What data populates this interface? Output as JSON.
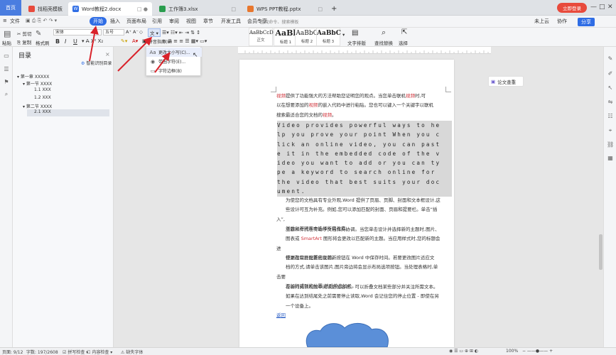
{
  "tabs": {
    "home": "首页",
    "items": [
      {
        "label": "找稻壳模板",
        "color": "#e84a3c"
      },
      {
        "label": "Word教程2.docx",
        "color": "#2f6de5"
      },
      {
        "label": "工作簿3.xlsx",
        "color": "#2a9d4e"
      },
      {
        "label": "WPS PPT教程.pptx",
        "color": "#e8772e"
      }
    ],
    "add": "+",
    "login": "立即登录"
  },
  "menubar": {
    "file": "文件",
    "start": "开始",
    "items": [
      "插入",
      "页面布局",
      "引用",
      "审阅",
      "视图",
      "章节",
      "开发工具",
      "会员专享"
    ],
    "search_placeholder": "查找命令、搜索模板",
    "right": [
      "未上云",
      "协作",
      "分享"
    ]
  },
  "ribbon": {
    "paste": "粘贴",
    "cut": "剪切",
    "copy": "复制",
    "format_painter": "格式刷",
    "font_name": "宋体",
    "font_size": "五号",
    "bold": "B",
    "italic": "I",
    "underline": "U",
    "styles": [
      {
        "sample": "AaBbCcDd",
        "label": "正文"
      },
      {
        "sample": "AaBl",
        "label": "标题 1"
      },
      {
        "sample": "AaBbC",
        "label": "标题 2"
      },
      {
        "sample": "AaBbC",
        "label": "标题 3"
      }
    ],
    "text_layout": "文字排版",
    "find_replace": "查找替换",
    "select": "选择"
  },
  "toc": {
    "title": "目录",
    "smart": "智能识别目录",
    "items": [
      {
        "label": "第一章 XXXXX",
        "level": 1
      },
      {
        "label": "第一节 XXXX",
        "level": 2
      },
      {
        "label": "1.1 XXX",
        "level": 3
      },
      {
        "label": "1.2 XXX",
        "level": 3
      },
      {
        "label": "第二节 XXXX",
        "level": 2
      },
      {
        "label": "2.1 XXX",
        "level": 3,
        "selected": true
      }
    ]
  },
  "dropdown": {
    "items": [
      {
        "icon": "Aa",
        "label": "拼音指南(U)"
      },
      {
        "icon": "Aa",
        "label": "更改大小写(C)..."
      },
      {
        "icon": "◉",
        "label": "带圈字符(E)..."
      },
      {
        "icon": "▭",
        "label": "字符边框(B)"
      }
    ]
  },
  "document": {
    "para1": [
      [
        {
          "t": "视频",
          "k": 1
        },
        {
          "t": "提供了功能强大的方法帮助您证明您的观点。当您单击联机"
        },
        {
          "t": "视频",
          "k": 1
        },
        {
          "t": "时,可"
        }
      ],
      [
        {
          "t": "以在想要添加的"
        },
        {
          "t": "视频",
          "k": 1
        },
        {
          "t": "的嵌入代码中进行粘贴。您也可以键入一个关键字以联机"
        }
      ],
      [
        {
          "t": "搜索最适合您的文档的"
        },
        {
          "t": "视频",
          "k": 1
        },
        {
          "t": "。"
        }
      ]
    ],
    "english_lines": [
      "Video provides powerful ways to he",
      "lp you prove your point When you c",
      "lick an online video, you can past",
      "e it in the embedded code of the v",
      "ideo you want to add or you can ty",
      "pe a keyword to search online for",
      "the video that best suits your doc",
      "ument."
    ],
    "para2": [
      "为使您的文档具有专业外观,Word 提供了页眉、页脚、封面和文本框设计,这",
      "些设计可互为补充。例如,您可以添加匹配的封面、页眉和提要栏。单击“插入”,",
      "然后从不同库中选择所需元素。"
    ],
    "para3": [
      [
        {
          "t": "主题和样式也有助于文档保持协调。当您单击设计并选择新的主题时,图片、"
        }
      ],
      [
        {
          "t": "图表或 "
        },
        {
          "t": "SmartArt",
          "k": 1
        },
        {
          "t": " 图形将会更改以匹配新的主题。当应用样式时,您的标题会进"
        }
      ],
      [
        {
          "t": "行更改以匹配新的主题。"
        }
      ]
    ],
    "para4": [
      "使用在需要位置出现的新按钮在 Word 中保存时间。若要更改图片适应文",
      "档的方式,请单击该图片,图片旁边将会显示布局选项按钮。当处理表格时,单击要",
      "添加行或列的位置,然后单击加号。"
    ],
    "para5": [
      "在新的阅读视图中阅读更加容易。可以折叠文档某些部分并关注所需文本。",
      "如果在达到结尾处之前需要停止读取,Word 会记住您的停止位置 - 即使在另",
      "一个设备上。"
    ],
    "link": "返回"
  },
  "paper_check": "论文查重",
  "status": {
    "page": "页面: 9/12",
    "words": "字数: 197/2608",
    "spell": "拼写检查",
    "content_check": "内容检查",
    "missing_font": "缺失字体",
    "zoom": "100%"
  },
  "colors": {
    "accent": "#2f6de5",
    "keyword": "#d0323a",
    "arrow": "#d9232b",
    "cloud": "#5b8fd8"
  }
}
